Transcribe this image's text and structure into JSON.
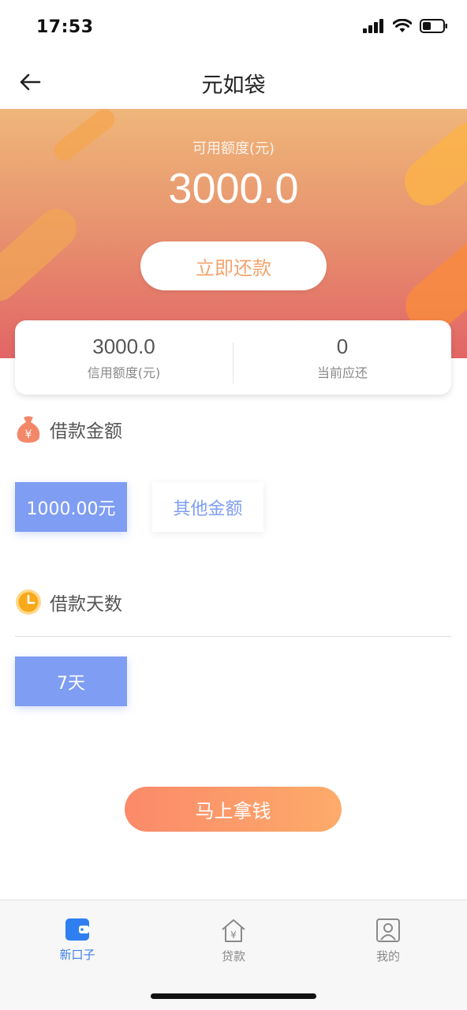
{
  "status_bar": {
    "time": "17:53"
  },
  "nav": {
    "title": "元如袋"
  },
  "hero": {
    "label": "可用额度(元)",
    "amount": "3000.0",
    "repay_button": "立即还款"
  },
  "summary": {
    "credit_value": "3000.0",
    "credit_label": "信用额度(元)",
    "due_value": "0",
    "due_label": "当前应还"
  },
  "loan_amount": {
    "title": "借款金额",
    "options": [
      "1000.00元",
      "其他金额"
    ],
    "selected": "1000.00元"
  },
  "loan_days": {
    "title": "借款天数",
    "options": [
      "7天"
    ],
    "selected": "7天"
  },
  "cta": {
    "label": "马上拿钱"
  },
  "tabs": [
    {
      "label": "新口子",
      "icon": "wallet-icon",
      "active": true
    },
    {
      "label": "贷款",
      "icon": "house-yen-icon",
      "active": false
    },
    {
      "label": "我的",
      "icon": "user-icon",
      "active": false
    }
  ],
  "colors": {
    "accent_blue": "#7f9df2",
    "tab_active": "#3e82e8",
    "hero_top": "#efb67a",
    "hero_bottom": "#e26566",
    "cta_start": "#fb8a6a",
    "cta_end": "#fdab6a"
  }
}
